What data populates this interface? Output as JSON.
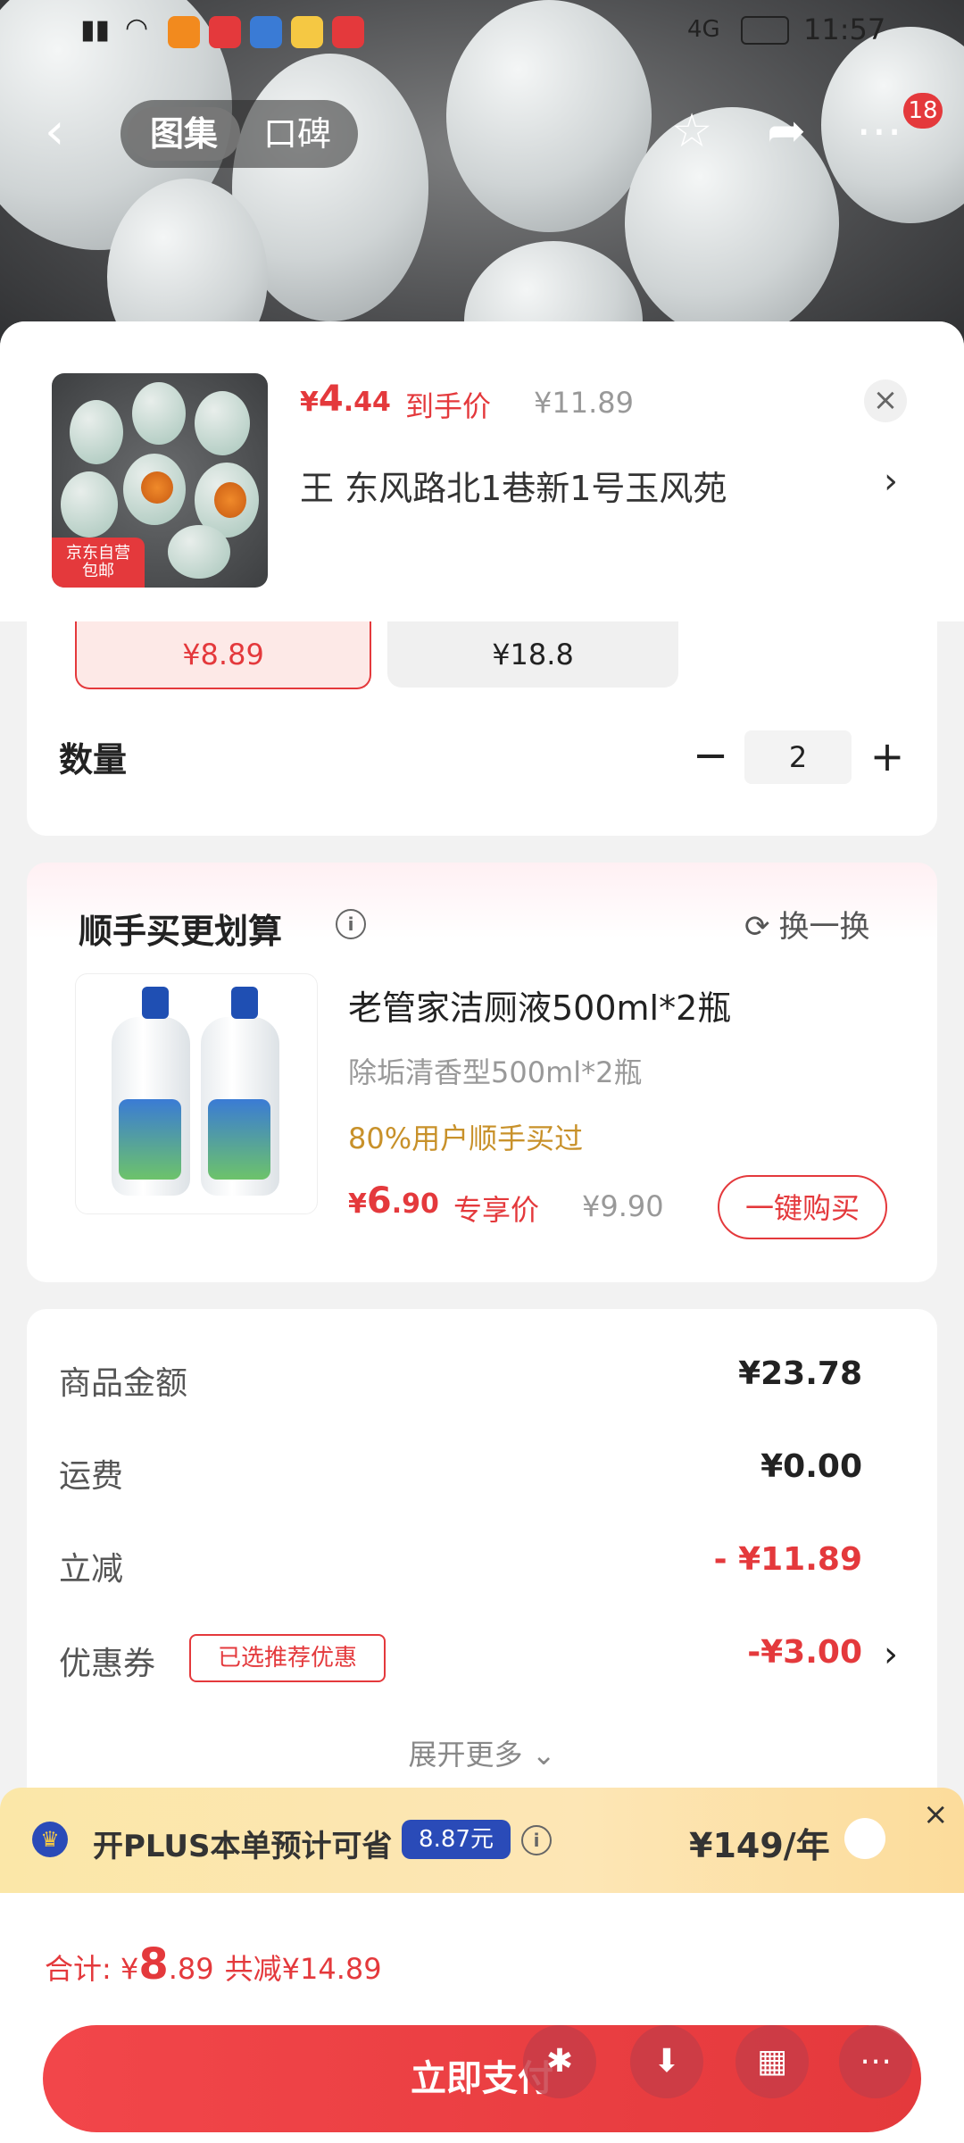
{
  "status": {
    "time": "11:57",
    "network": "4G"
  },
  "nav": {
    "back_icon": "chevron-left",
    "tabs": [
      "图集",
      "口碑"
    ],
    "active_tab": 0,
    "cart_count": "18"
  },
  "header": {
    "badge_text": "京东自营\n包邮",
    "price_symbol": "¥",
    "price_int": "4",
    "price_dec": ".44",
    "price_label": "到手价",
    "original_price": "¥11.89",
    "address": "王  东风路北1巷新1号玉风苑"
  },
  "options": {
    "selected": "¥8.89",
    "other": "¥18.8"
  },
  "quantity": {
    "label": "数量",
    "value": "2"
  },
  "upsell": {
    "title": "顺手买更划算",
    "swap_label": "换一换",
    "product_name": "老管家洁厕液500ml*2瓶",
    "product_sub": "除垢清香型500ml*2瓶",
    "social_proof": "80%用户顺手买过",
    "price_symbol": "¥",
    "price_int": "6",
    "price_dec": ".90",
    "price_label": "专享价",
    "original_price": "¥9.90",
    "buy_label": "一键购买"
  },
  "summary": {
    "rows": [
      {
        "label": "商品金额",
        "value": "¥23.78"
      },
      {
        "label": "运费",
        "value": "¥0.00"
      },
      {
        "label": "立减",
        "value": "- ¥11.89"
      },
      {
        "label": "优惠券",
        "value": "-¥3.00"
      }
    ],
    "coupon_tag": "已选推荐优惠",
    "expand_label": "展开更多"
  },
  "plus": {
    "text": "开PLUS本单预计可省",
    "saving": "8.87元",
    "price": "¥149/年"
  },
  "footer": {
    "total_label": "合计: ¥",
    "total_int": "8",
    "total_dec": ".89",
    "discount_label": "共减¥14.89",
    "pay_label": "立即支付"
  },
  "colors": {
    "accent": "#e4393c",
    "plus_blue": "#2a4bb8",
    "gold": "#c8912a"
  }
}
